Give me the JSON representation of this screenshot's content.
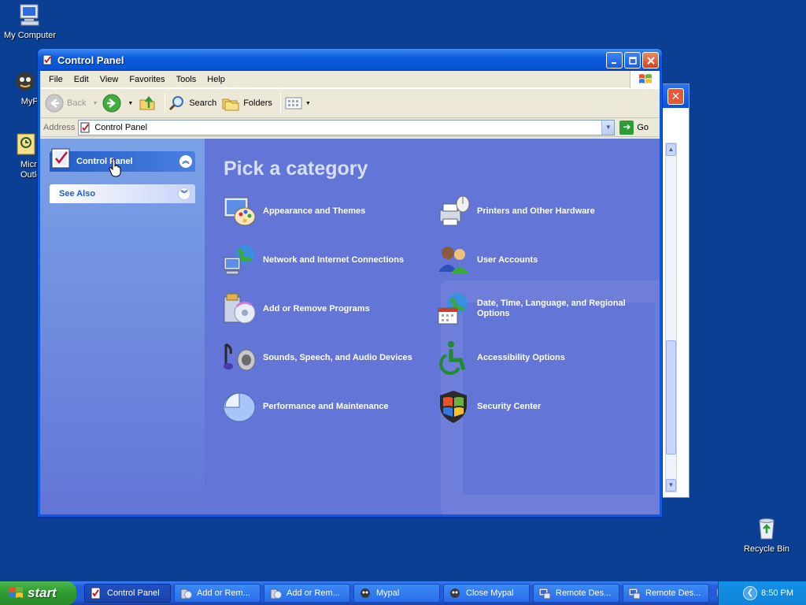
{
  "desktop": {
    "icons": [
      {
        "label": "My Computer",
        "icon": "my-computer-icon"
      },
      {
        "label": "MyPal",
        "icon": "mypal-icon"
      },
      {
        "label": "Micros Outlo",
        "icon": "outlook-icon"
      },
      {
        "label": "Recycle Bin",
        "icon": "recycle-bin-icon"
      }
    ]
  },
  "window": {
    "title": "Control Panel",
    "menu": [
      "File",
      "Edit",
      "View",
      "Favorites",
      "Tools",
      "Help"
    ],
    "toolbar": {
      "back": "Back",
      "search": "Search",
      "folders": "Folders"
    },
    "address": {
      "label": "Address",
      "value": "Control Panel",
      "go": "Go"
    },
    "leftpane": {
      "title": "Control Panel",
      "see_also": "See Also"
    },
    "main": {
      "heading": "Pick a category",
      "categories": [
        {
          "label": "Appearance and Themes",
          "icon": "appearance-themes-icon"
        },
        {
          "label": "Printers and Other Hardware",
          "icon": "printer-hardware-icon"
        },
        {
          "label": "Network and Internet Connections",
          "icon": "network-icon"
        },
        {
          "label": "User Accounts",
          "icon": "user-accounts-icon"
        },
        {
          "label": "Add or Remove Programs",
          "icon": "add-remove-programs-icon"
        },
        {
          "label": "Date, Time, Language, and Regional Options",
          "icon": "date-time-icon"
        },
        {
          "label": "Sounds, Speech, and Audio Devices",
          "icon": "sound-icon"
        },
        {
          "label": "Accessibility Options",
          "icon": "accessibility-icon"
        },
        {
          "label": "Performance and Maintenance",
          "icon": "performance-icon"
        },
        {
          "label": "Security Center",
          "icon": "security-shield-icon"
        }
      ]
    }
  },
  "taskbar": {
    "start": "start",
    "tasks": [
      {
        "label": "Control Panel",
        "active": true
      },
      {
        "label": "Add or Rem...",
        "active": false
      },
      {
        "label": "Add or Rem...",
        "active": false
      },
      {
        "label": "Mypal",
        "active": false
      },
      {
        "label": "Close Mypal",
        "active": false
      },
      {
        "label": "Remote Des...",
        "active": false
      },
      {
        "label": "Remote Des...",
        "active": false
      }
    ],
    "clock": "8:50 PM"
  },
  "colors": {
    "desktop": "#0b3f94",
    "title_bar": "#0b5bdc",
    "category_pane": "#6375d6",
    "start_button": "#2e9b2e"
  }
}
